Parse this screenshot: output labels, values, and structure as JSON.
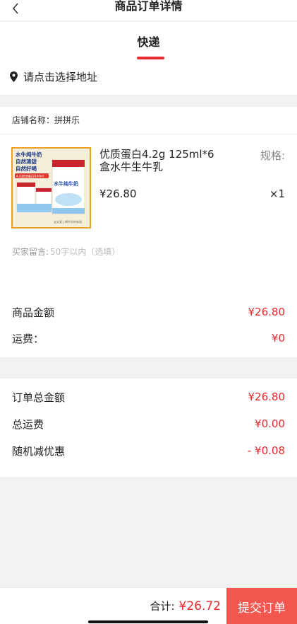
{
  "header": {
    "title": "商品订单详情"
  },
  "delivery": {
    "tab_label": "快递",
    "address_placeholder": "请点击选择地址"
  },
  "shop": {
    "name_label": "店铺名称：",
    "name": "拼拼乐",
    "product": {
      "name": "优质蛋白4.2g 125ml*6盒水牛生牛乳",
      "spec_label": "规格:",
      "price": "¥26.80",
      "quantity": "×1",
      "image": {
        "banner_lines": [
          "水牛纯牛奶",
          "自然清甜",
          "自然好喝"
        ],
        "badge": "4.2g优质蛋白/100ml",
        "box_brand": "水牛纯牛奶",
        "footer": "宝宝爱上喝牛奶的味道"
      }
    },
    "remark_label": "买家留言:",
    "remark_placeholder": "50字以内（选填）"
  },
  "amounts": {
    "goods_label": "商品金额",
    "goods_value": "¥26.80",
    "freight_label": "运费：",
    "freight_value": "¥0"
  },
  "totals": {
    "order_total_label": "订单总金额",
    "order_total_value": "¥26.80",
    "total_freight_label": "总运费",
    "total_freight_value": "¥0.00",
    "discount_label": "随机减优惠",
    "discount_value": "- ¥0.08"
  },
  "footer": {
    "sum_label": "合计:",
    "sum_value": "¥26.72",
    "submit_label": "提交订单"
  },
  "colors": {
    "accent": "#e8292f",
    "submit_bg": "#f2564f",
    "thumb_border": "#e9a12b"
  },
  "icons": {
    "back": "chevron-left-icon",
    "location": "location-pin-icon"
  }
}
